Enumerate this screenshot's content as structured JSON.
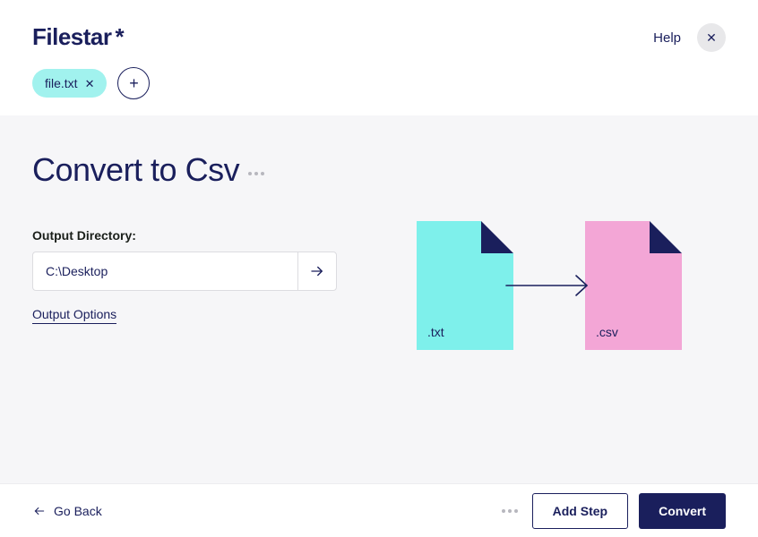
{
  "app": {
    "name": "Filestar",
    "help_label": "Help"
  },
  "files": {
    "items": [
      {
        "name": "file.txt"
      }
    ]
  },
  "page": {
    "title": "Convert to Csv",
    "output_dir_label": "Output Directory:",
    "output_dir_value": "C:\\Desktop",
    "output_options_label": "Output Options"
  },
  "conversion": {
    "source_ext": ".txt",
    "dest_ext": ".csv"
  },
  "footer": {
    "go_back_label": "Go Back",
    "add_step_label": "Add Step",
    "convert_label": "Convert"
  }
}
